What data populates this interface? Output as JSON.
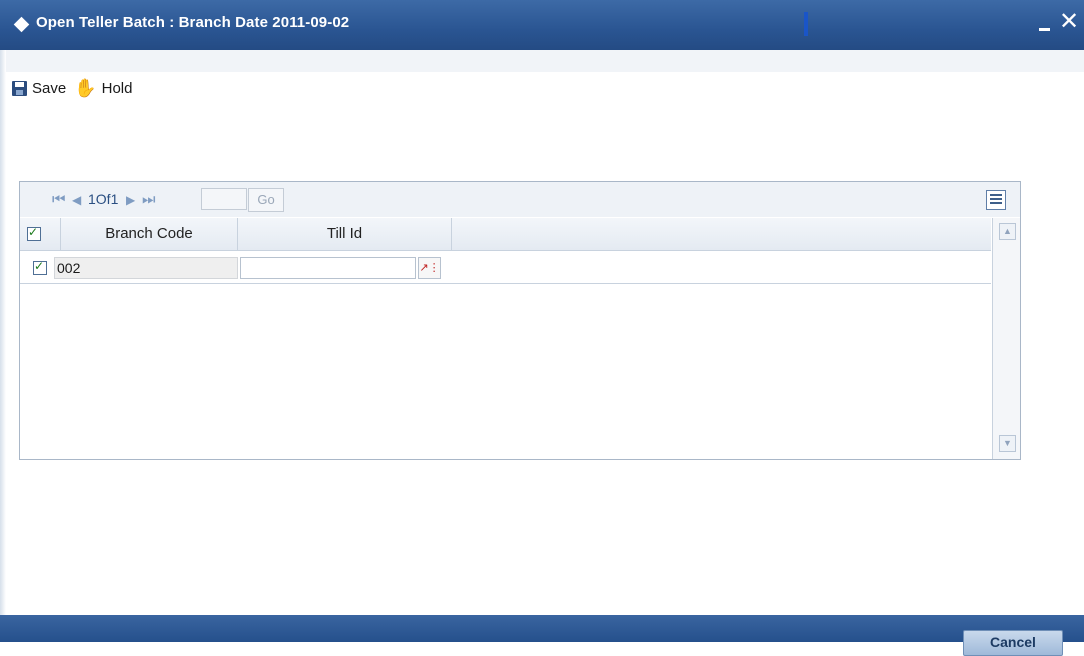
{
  "window": {
    "title": "Open Teller Batch : Branch Date 2011-09-02",
    "minimize_icon": "minimize-icon",
    "close_icon": "close-icon"
  },
  "toolbar": {
    "save_label": "Save",
    "save_icon": "save-disk-icon",
    "hold_label": "Hold",
    "hold_icon": "hand-icon"
  },
  "grid": {
    "pager": {
      "page_text": "1Of1",
      "go_label": "Go",
      "page_input_value": ""
    },
    "columns": [
      "Branch Code",
      "Till Id"
    ],
    "rows": [
      {
        "checked": true,
        "branch_code": "002",
        "till_id": ""
      }
    ],
    "header_checked": true
  },
  "footer": {
    "cancel_label": "Cancel"
  },
  "colors": {
    "titlebar": "#2a5592",
    "accent": "#3d6aa6",
    "panel_border": "#a9b7c8"
  }
}
